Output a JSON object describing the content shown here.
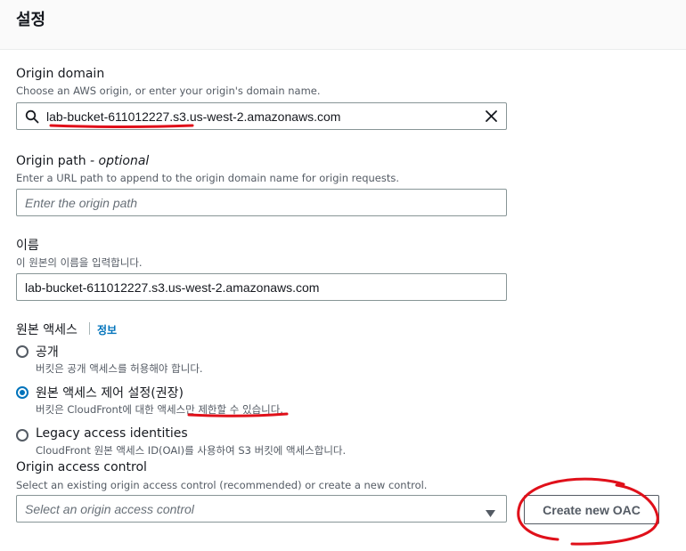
{
  "header": {
    "title": "설정"
  },
  "origin_domain": {
    "label": "Origin domain",
    "description": "Choose an AWS origin, or enter your origin's domain name.",
    "value": "lab-bucket-611012227.s3.us-west-2.amazonaws.com"
  },
  "origin_path": {
    "label": "Origin path",
    "label_suffix": "- optional",
    "description": "Enter a URL path to append to the origin domain name for origin requests.",
    "placeholder": "Enter the origin path"
  },
  "name": {
    "label": "이름",
    "description": "이 원본의 이름을 입력합니다.",
    "value": "lab-bucket-611012227.s3.us-west-2.amazonaws.com"
  },
  "origin_access": {
    "label": "원본 액세스",
    "info_link": "정보",
    "options": [
      {
        "label": "공개",
        "description": "버킷은 공개 액세스를 허용해야 합니다.",
        "checked": false
      },
      {
        "label": "원본 액세스 제어 설정(권장)",
        "description": "버킷은 CloudFront에 대한 액세스만 제한할 수 있습니다.",
        "checked": true
      },
      {
        "label": "Legacy access identities",
        "description": "CloudFront 원본 액세스 ID(OAI)를 사용하여 S3 버킷에 액세스합니다.",
        "checked": false
      }
    ]
  },
  "origin_access_control": {
    "label": "Origin access control",
    "description": "Select an existing origin access control (recommended) or create a new control.",
    "placeholder": "Select an origin access control",
    "create_button": "Create new OAC"
  },
  "colors": {
    "annotation": "#e0101a",
    "accent": "#0073bb"
  }
}
